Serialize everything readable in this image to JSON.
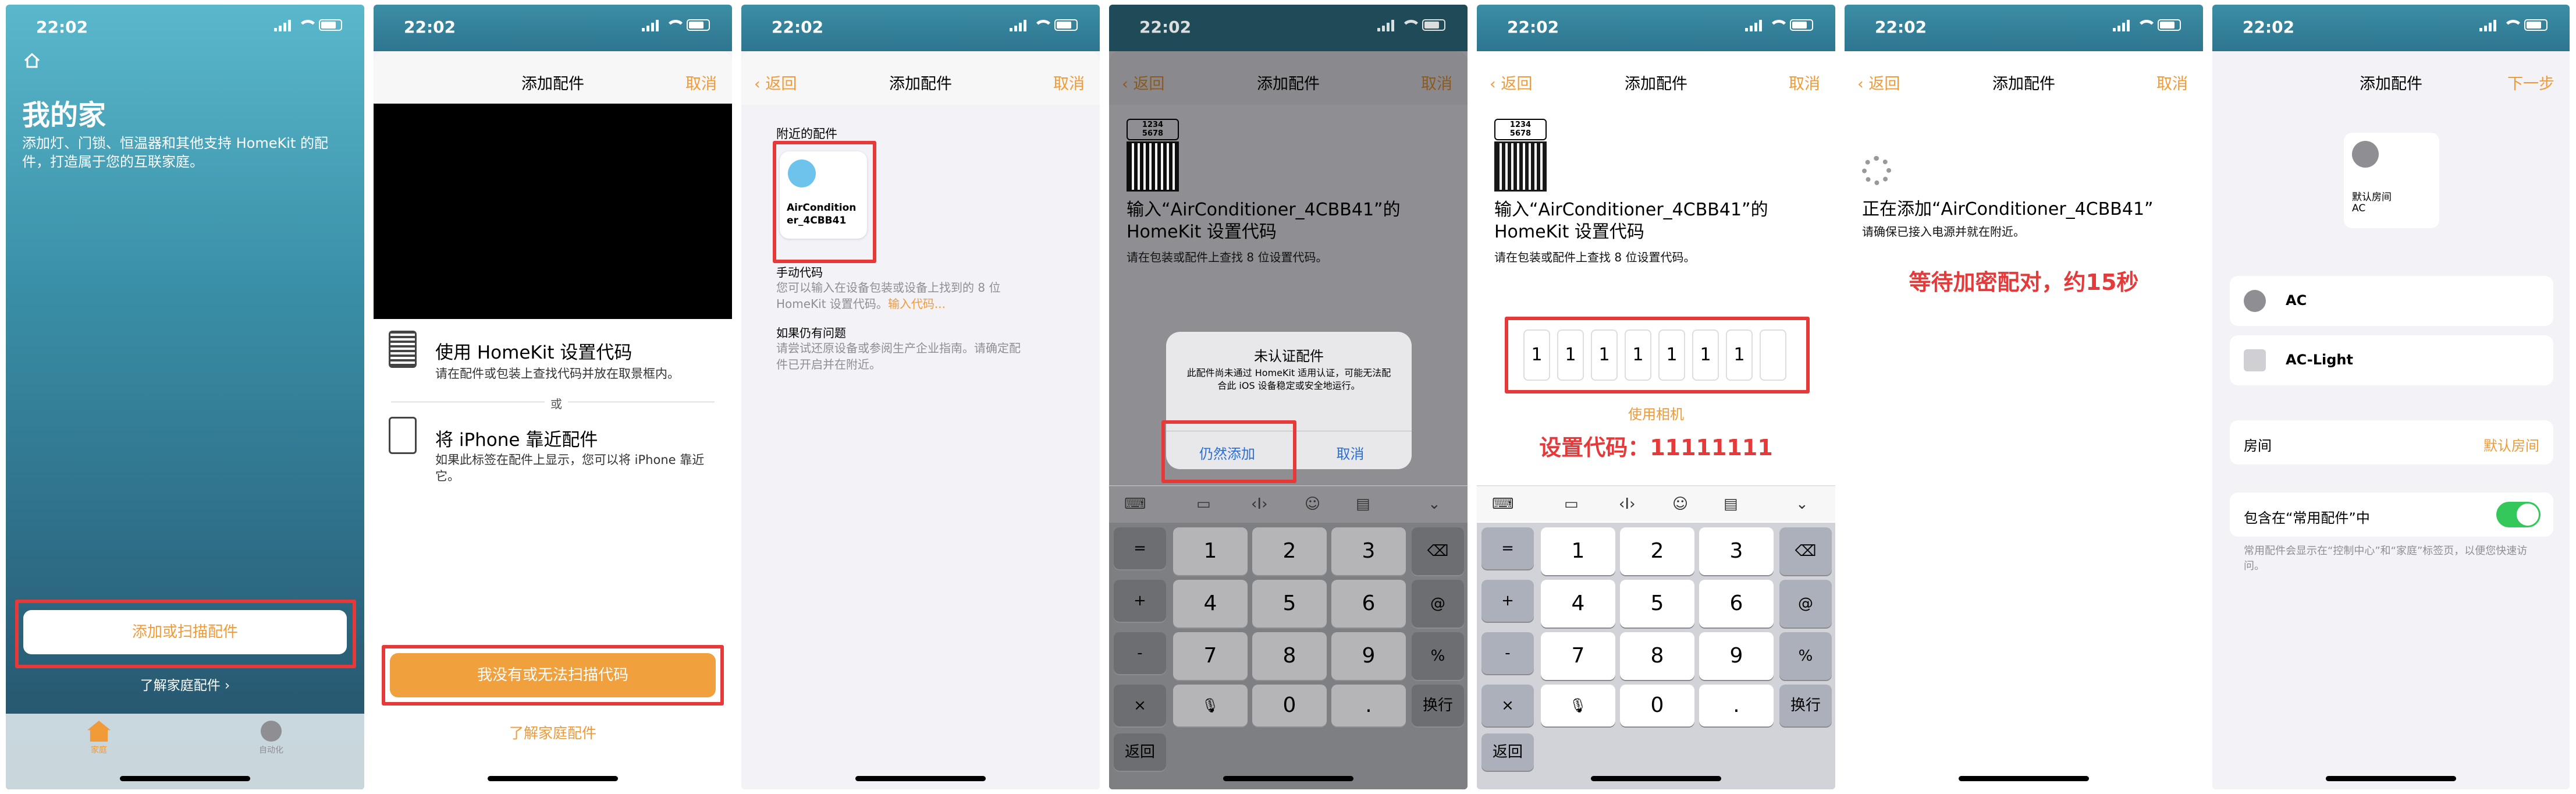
{
  "status_time": "22:02",
  "p1": {
    "title": "我的家",
    "desc": "添加灯、门锁、恒温器和其他支持 HomeKit 的配件，打造属于您的互联家庭。",
    "add_button": "添加或扫描配件",
    "learn_link": "了解家庭配件 ›",
    "tab_home": "家庭",
    "tab_auto": "自动化"
  },
  "p2": {
    "nav_title": "添加配件",
    "cancel": "取消",
    "opt1_title": "使用 HomeKit 设置代码",
    "opt1_desc": "请在配件或包装上查找代码并放在取景框内。",
    "or": "或",
    "opt2_title": "将 iPhone 靠近配件",
    "opt2_desc": "如果此标签在配件上显示，您可以将 iPhone 靠近它。",
    "no_code_button": "我没有或无法扫描代码",
    "learn_link": "了解家庭配件"
  },
  "p3": {
    "back": "返回",
    "nav_title": "添加配件",
    "cancel": "取消",
    "nearby_header": "附近的配件",
    "accessory_name": "AirConditioner_4CBB41",
    "manual_title": "手动代码",
    "manual_desc": "您可以输入在设备包装或设备上找到的 8 位 HomeKit 设置代码。",
    "manual_link": "输入代码...",
    "trouble_title": "如果仍有问题",
    "trouble_desc": "请尝试还原设备或参阅生产企业指南。请确定配件已开启并在附近。"
  },
  "p4": {
    "back": "返回",
    "nav_title": "添加配件",
    "cancel": "取消",
    "qr_num": "1234\n5678",
    "heading": "输入“AirConditioner_4CBB41”的 HomeKit 设置代码",
    "sub": "请在包装或配件上查找 8 位设置代码。",
    "alert_title": "未认证配件",
    "alert_body": "此配件尚未通过 HomeKit 适用认证，可能无法配合此 iOS 设备稳定或安全地运行。",
    "alert_add": "仍然添加",
    "alert_cancel": "取消"
  },
  "p5": {
    "back": "返回",
    "nav_title": "添加配件",
    "cancel": "取消",
    "qr_num": "1234\n5678",
    "heading": "输入“AirConditioner_4CBB41”的 HomeKit 设置代码",
    "sub": "请在包装或配件上查找 8 位设置代码。",
    "digits": [
      "1",
      "1",
      "1",
      "1",
      "1",
      "1",
      "1",
      ""
    ],
    "use_camera": "使用相机",
    "annotation": "设置代码：11111111"
  },
  "p6": {
    "back": "返回",
    "nav_title": "添加配件",
    "cancel": "取消",
    "heading": "正在添加“AirConditioner_4CBB41”",
    "sub": "请确保已接入电源并就在附近。",
    "annotation": "等待加密配对，约15秒"
  },
  "p7": {
    "nav_title": "添加配件",
    "next": "下一步",
    "tile_room": "默认房间",
    "tile_name": "AC",
    "item1": "AC",
    "item2": "AC-Light",
    "room_label": "房间",
    "room_value": "默认房间",
    "fav_label": "包含在“常用配件”中",
    "fav_desc": "常用配件会显示在“控制中心”和“家庭”标签页，以便您快速访问。"
  },
  "keyboard": {
    "side": [
      "=",
      "+",
      "-",
      "×",
      "返回"
    ],
    "numbers": [
      "1",
      "2",
      "3",
      "4",
      "5",
      "6",
      "7",
      "8",
      "9",
      "0",
      "."
    ],
    "right": [
      "⌫",
      "@",
      "%",
      "换行"
    ]
  },
  "colors": {
    "accent": "#f19a38",
    "red": "#e63a3a",
    "toggle": "#34c759"
  }
}
